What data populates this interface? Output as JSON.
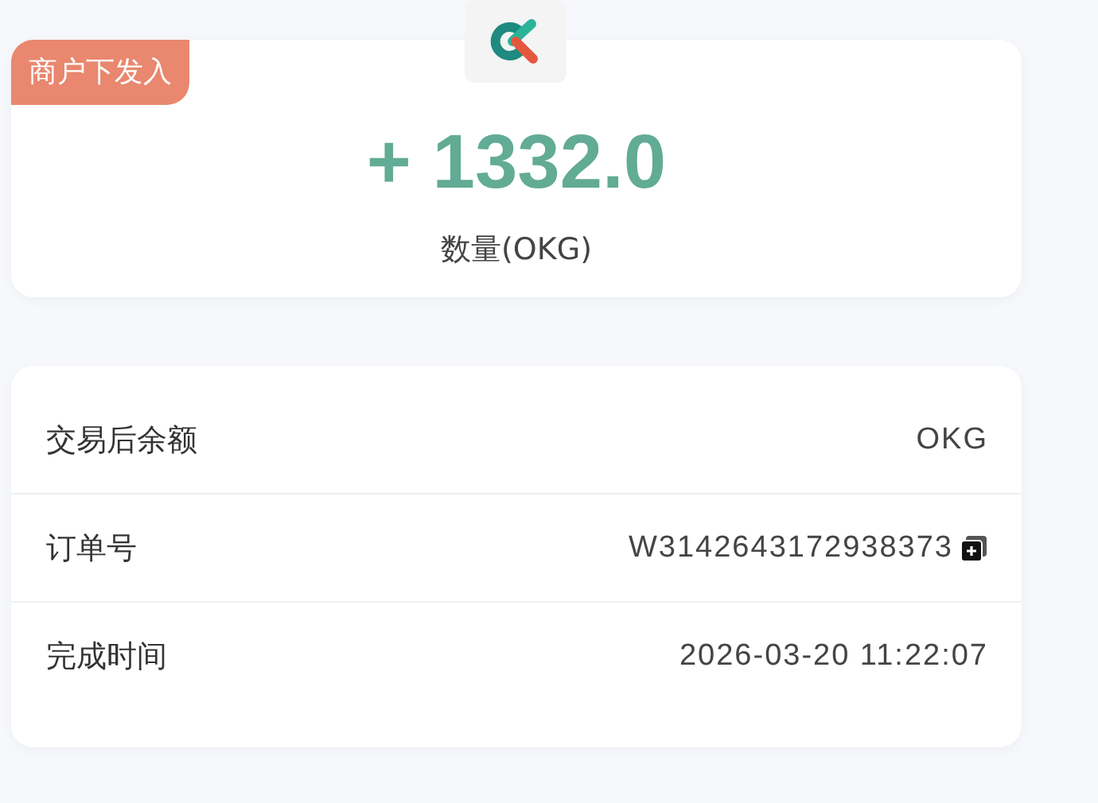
{
  "summary": {
    "badge": "商户下发入",
    "amount": "+ 1332.0",
    "amount_label": "数量(OKG)"
  },
  "details": [
    {
      "label": "交易后余额",
      "value": "OKG",
      "kind": "text"
    },
    {
      "label": "订单号",
      "value": "W3142643172938373",
      "kind": "copy"
    },
    {
      "label": "完成时间",
      "value": "2026-03-20 11:22:07",
      "kind": "text"
    }
  ]
}
